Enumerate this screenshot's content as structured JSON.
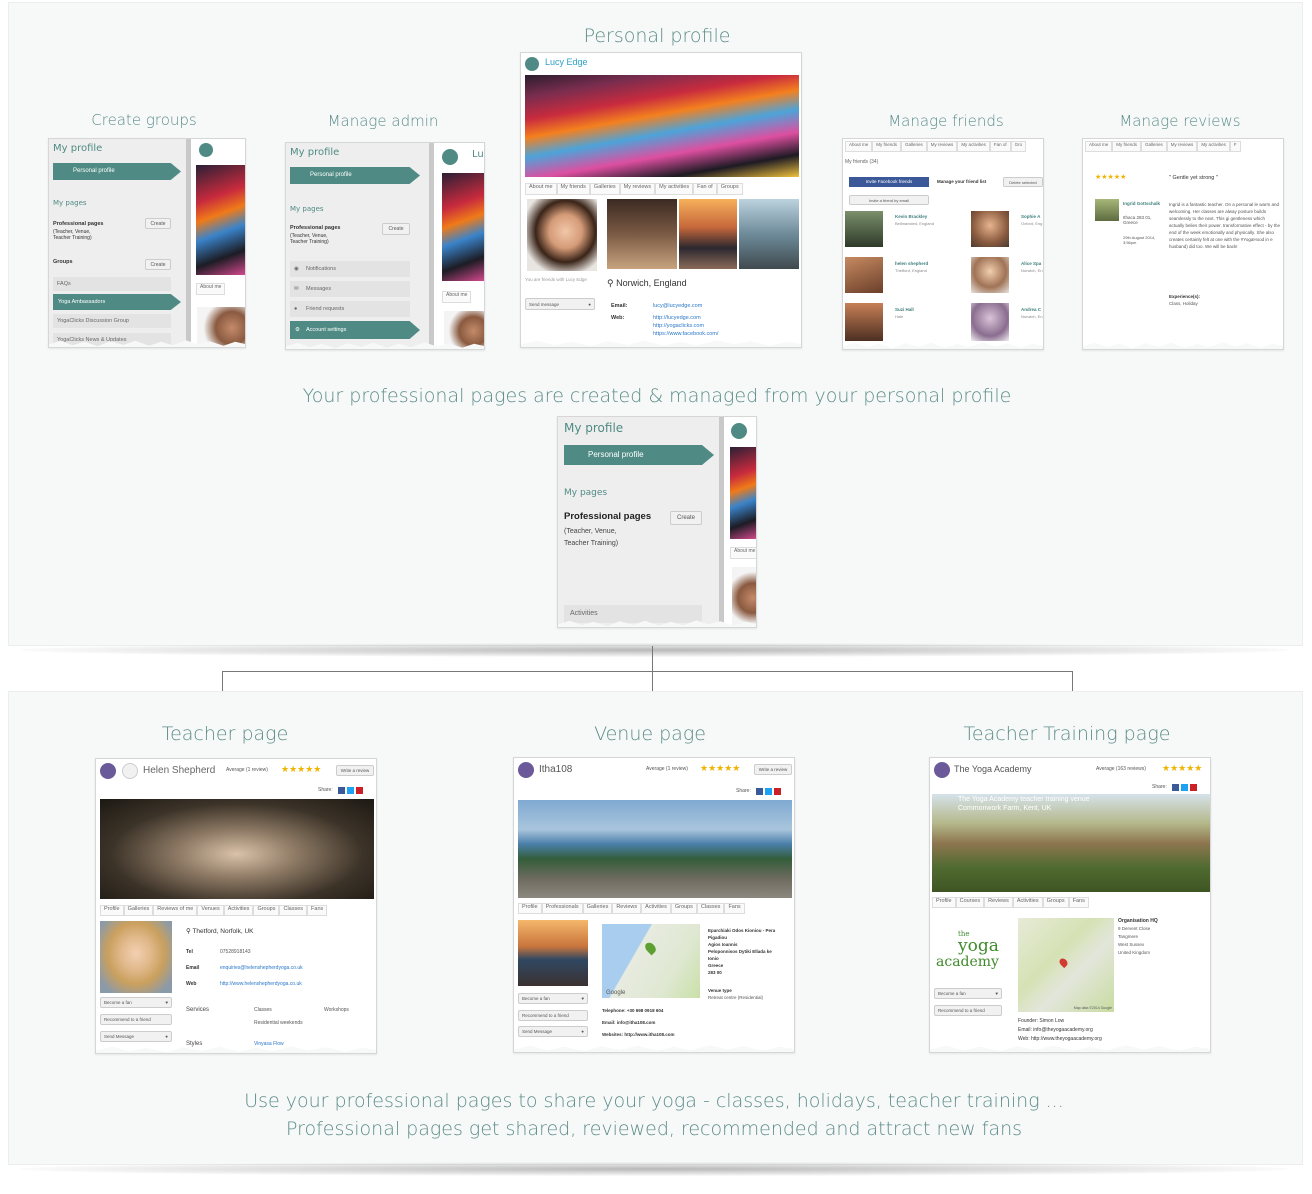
{
  "titles": {
    "create_groups": "Create groups",
    "manage_admin": "Manage admin",
    "personal_profile": "Personal profile",
    "manage_friends": "Manage friends",
    "manage_reviews": "Manage reviews",
    "mid_caption": "Your professional pages are created & managed from your personal profile",
    "teacher_page": "Teacher page",
    "venue_page": "Venue page",
    "training_page": "Teacher Training page",
    "bottom_line1": "Use your professional pages to share your yoga - classes, holidays, teacher training ...",
    "bottom_line2": "Professional pages get shared, reviewed, recommended and attract new fans"
  },
  "sidebar": {
    "my_profile": "My profile",
    "personal_profile": "Personal profile",
    "my_pages": "My pages",
    "professional_pages": "Professional pages",
    "pro_sub1": "(Teacher, Venue,",
    "pro_sub2": "Teacher Training)",
    "create": "Create",
    "groups": "Groups",
    "faqs": "FAQs",
    "yoga_ambassadors": "Yoga Ambassadors",
    "discussion_group": "YogaClicks Discussion Group",
    "news": "YogaClicks News & Updates",
    "notifications": "Notifications",
    "messages": "Messages",
    "friend_requests": "Friend requests",
    "account_settings": "Account settings",
    "activities": "Activities",
    "about_me": "About me",
    "lu": "Lu"
  },
  "profile": {
    "name": "Lucy Edge",
    "tabs": [
      "About me",
      "My friends",
      "Galleries",
      "My reviews",
      "My activities",
      "Fan of",
      "Groups"
    ],
    "friends_note": "You are friends with Lucy Edge",
    "send_message": "Send message",
    "location": "Norwich, England",
    "email_label": "Email:",
    "email": "lucy@lucyedge.com",
    "web_label": "Web:",
    "web1": "http://lucyedge.com",
    "web2": "http://yogaclicks.com",
    "web3": "https://www.facebook.com/"
  },
  "friends": {
    "tabs": [
      "About me",
      "My friends",
      "Galleries",
      "My reviews",
      "My activities",
      "Fan of",
      "Gro"
    ],
    "count": "My friends (34)",
    "invite_fb": "Invite Facebook friends",
    "manage_list": "Manage your friend list",
    "delete": "Delete selected",
    "invite_email": "Invite a friend by email",
    "people": [
      {
        "name": "Kevin Brackley",
        "place": "Bellmansted, England"
      },
      {
        "name": "Sophie A",
        "place": "Oxford, Eng"
      },
      {
        "name": "helen shepherd",
        "place": "Thetford, England"
      },
      {
        "name": "Alice Spa",
        "place": "Norwich, En"
      },
      {
        "name": "Suzi Hall",
        "place": "Hale"
      },
      {
        "name": "Andrea C",
        "place": "Norwich, En"
      }
    ]
  },
  "reviews": {
    "tabs": [
      "About me",
      "My friends",
      "Galleries",
      "My reviews",
      "My activities",
      "F"
    ],
    "stars": "★★★★★",
    "quote": "\" Gentle yet strong \"",
    "reviewer": "Ingrid Gottschalk",
    "place": "Ithaca 283 01, Greece",
    "date": "29th August 2014, 3:56pm",
    "text": "Ingrid is a fantastic teacher. On a personal le warm and welcoming. Her classes are alway posture builds seamlessly to the next. This gi gentleness which actually belies their power. transformative effect - by the end of the week emotionally and physically. She also creates certainly felt at one with the #YogaHood in e husband) did too. We will be back!",
    "exp_label": "Experience(s):",
    "exp": "Class, Holiday"
  },
  "teacher": {
    "name": "Helen Shepherd",
    "avg": "Average (1 review)",
    "stars": "★★★★★",
    "write": "Write a review",
    "share": "Share:",
    "tabs": [
      "Profile",
      "Galleries",
      "Reviews of me",
      "Venues",
      "Activities",
      "Groups",
      "Classes",
      "Fans"
    ],
    "location": "Thetford, Norfolk, UK",
    "tel_label": "Tel",
    "tel": "07528918143",
    "email_label": "Email",
    "email": "enquiries@helenshepherdyoga.co.uk",
    "web_label": "Web",
    "web": "http://www.helenshepherdyoga.co.uk",
    "fan": "Become a fan",
    "recommend": "Recommend to a friend",
    "send": "Send Message",
    "services_label": "Services",
    "services1": "Classes",
    "services2": "Residential weekends",
    "services3": "Workshops",
    "styles_label": "Styles",
    "styles": "Vinyasa Flow"
  },
  "venue": {
    "name": "Itha108",
    "avg": "Average (1 review)",
    "stars": "★★★★★",
    "write": "Write a review",
    "share": "Share:",
    "tabs": [
      "Profile",
      "Professionals",
      "Galleries",
      "Reviews",
      "Activities",
      "Groups",
      "Classes",
      "Fans"
    ],
    "fan": "Become a fan",
    "recommend": "Recommend to a friend",
    "send": "Send Message",
    "addr1": "Eparchiaki Odos Kioniou - Pera",
    "addr2": "Pigadiou",
    "addr3": "Agios Ioannis",
    "addr4": "Peloponnisos Dytiki Ellada ke",
    "addr5": "Ionio",
    "addr6": "Greece",
    "addr7": "283 00",
    "type_label": "Venue type",
    "type": "Retreat centre (Residential)",
    "tel": "Telephone: +30 698 0918 604",
    "email": "Email: info@itha108.com",
    "web": "Websites: http://www.itha108.com",
    "google": "Google"
  },
  "training": {
    "name": "The Yoga Academy",
    "avg": "Average (163 reviews)",
    "stars": "★★★★★",
    "share": "Share:",
    "caption1": "The Yoga Academy teacher training venue",
    "caption2": "Commonwork Farm, Kent, UK",
    "tabs": [
      "Profile",
      "Courses",
      "Reviews",
      "Activities",
      "Groups",
      "Fans"
    ],
    "logo_the": "the",
    "logo_yoga": "yoga",
    "logo_academy": "academy",
    "fan": "Become a fan",
    "recommend": "Recommend to a friend",
    "org": "Organisation HQ",
    "addr1": "9 Dervent Close",
    "addr2": "Tangmere",
    "addr3": "West Sussex",
    "addr4": "United Kingdom",
    "founder": "Founder: Simon Low",
    "email": "Email: info@theyogaacademy.org",
    "web": "Web: http://www.theyogaacademy.org",
    "map_credit": "Map data ©2014 Google"
  },
  "colors": {
    "teal": "#4f8b84",
    "title": "#5c8d8a",
    "link": "#2a78c8",
    "star": "#f0b400"
  }
}
